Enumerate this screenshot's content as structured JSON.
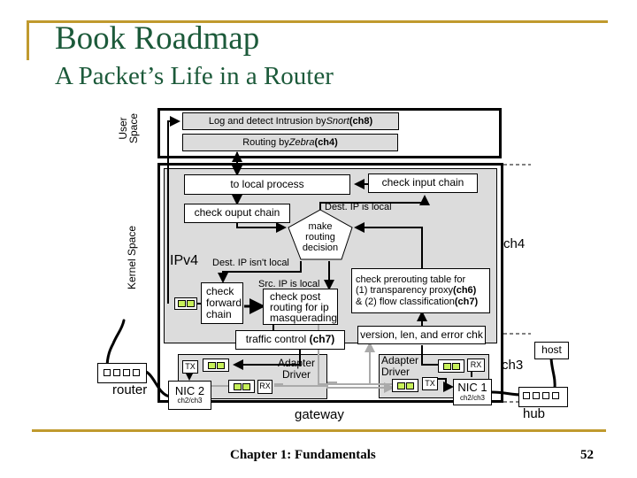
{
  "slide": {
    "title": "Book Roadmap",
    "subtitle": "A Packet’s Life in a Router",
    "footer": "Chapter 1: Fundamentals",
    "page_number": "52",
    "accent_color": "#c09a2e",
    "title_color": "#1c5a3a"
  },
  "diagram": {
    "user_space_label": "User Space",
    "user_space_line1": "User",
    "user_space_line2": "Space",
    "kernel_space_label": "Kernel Space",
    "snort_box": {
      "prefix": "Log and detect Intrusion by ",
      "italic": "Snort",
      "suffix": " (ch8)"
    },
    "zebra_box": {
      "prefix": "Routing by ",
      "italic": "Zebra",
      "suffix": " (ch4)"
    },
    "to_local_process": "to local process",
    "check_input_chain": "check input chain",
    "check_output_chain": "check ouput chain",
    "dest_ip_local": "Dest. IP is local",
    "routing_decision": [
      "make",
      "routing",
      "decision"
    ],
    "ipv4_label": "IPv4",
    "dest_ip_not_local": "Dest. IP isn't local",
    "src_ip_local": "Src. IP is local",
    "check_forward_chain": [
      "check",
      "forward",
      "chain"
    ],
    "check_post_routing": [
      "check post",
      "routing for ip",
      "masquerading"
    ],
    "prerouting": {
      "line1": "check prerouting table for",
      "line2_prefix": "(1) transparency proxy",
      "line2_bold": "(ch6)",
      "line3_prefix": "& (2) flow classification",
      "line3_bold": "(ch7)"
    },
    "traffic_control": {
      "prefix": "traffic control ",
      "bold": "(ch7)"
    },
    "version_check": "version, len, and error chk",
    "adapter_driver_left": [
      "Adapter",
      "Driver"
    ],
    "adapter_driver_right": [
      "Adapter",
      "Driver"
    ],
    "tx": "TX",
    "rx": "RX",
    "nic2": {
      "name": "NIC 2",
      "chapters": "ch2/ch3"
    },
    "nic1": {
      "name": "NIC 1",
      "chapters": "ch2/ch3"
    },
    "router_label": "router",
    "gateway_label": "gateway",
    "hub_label": "hub",
    "host_label": "host",
    "ch4_label": "ch4",
    "ch3_label": "ch3"
  }
}
